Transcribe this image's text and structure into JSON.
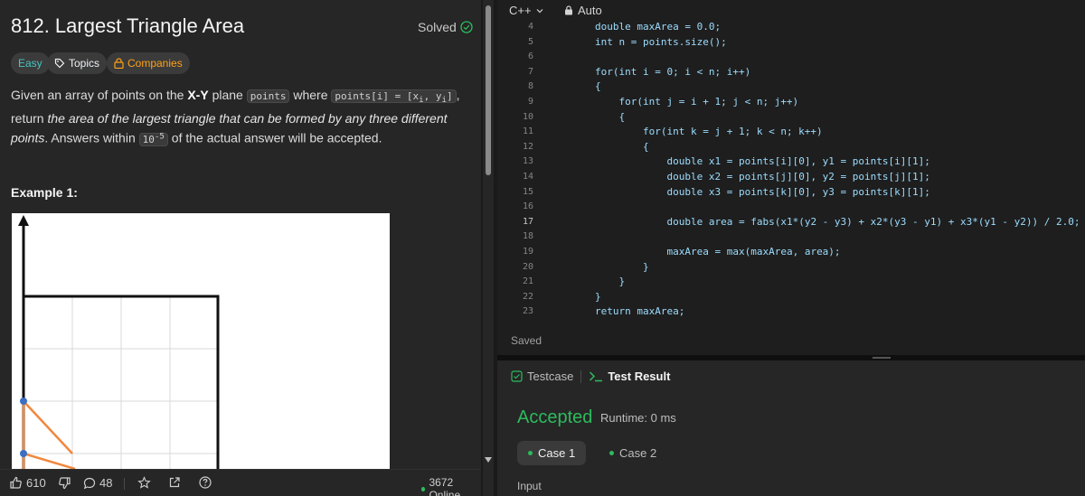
{
  "problem": {
    "title": "812. Largest Triangle Area",
    "solved_label": "Solved",
    "tags": {
      "difficulty": "Easy",
      "topics": "Topics",
      "companies": "Companies"
    },
    "description": {
      "part1": "Given an array of points on the ",
      "bold": "X-Y",
      "part2": " plane ",
      "code1": "points",
      "part3": " where ",
      "code2": "points[i] = [x",
      "code2_sub1": "i",
      "code2_mid": ", y",
      "code2_sub2": "i",
      "code2_end": "]",
      "part4": ", return ",
      "italic": "the area of the largest triangle that can be formed by any three different points",
      "part5": ". Answers within ",
      "code3": "10",
      "code3_sup": "-5",
      "part6": " of the actual answer will be accepted."
    },
    "example_title": "Example 1:"
  },
  "bottom_bar": {
    "likes": "610",
    "comments": "48",
    "online": "3672 Online"
  },
  "editor": {
    "language": "C++",
    "mode": "Auto",
    "saved": "Saved",
    "lines": [
      {
        "n": "4",
        "code": "double maxArea = 0.0;",
        "indent": 0
      },
      {
        "n": "5",
        "code": "int n = points.size();",
        "indent": 0
      },
      {
        "n": "6",
        "code": "",
        "indent": 0
      },
      {
        "n": "7",
        "code": "for(int i = 0; i < n; i++)",
        "indent": 0
      },
      {
        "n": "8",
        "code": "{",
        "indent": 0
      },
      {
        "n": "9",
        "code": "for(int j = i + 1; j < n; j++)",
        "indent": 1
      },
      {
        "n": "10",
        "code": "{",
        "indent": 1
      },
      {
        "n": "11",
        "code": "for(int k = j + 1; k < n; k++)",
        "indent": 2
      },
      {
        "n": "12",
        "code": "{",
        "indent": 2
      },
      {
        "n": "13",
        "code": "double x1 = points[i][0], y1 = points[i][1];",
        "indent": 3
      },
      {
        "n": "14",
        "code": "double x2 = points[j][0], y2 = points[j][1];",
        "indent": 3
      },
      {
        "n": "15",
        "code": "double x3 = points[k][0], y3 = points[k][1];",
        "indent": 3
      },
      {
        "n": "16",
        "code": "",
        "indent": 0
      },
      {
        "n": "17",
        "code": "double area = fabs(x1*(y2 - y3) + x2*(y3 - y1) + x3*(y1 - y2)) / 2.0;",
        "indent": 3
      },
      {
        "n": "18",
        "code": "",
        "indent": 0
      },
      {
        "n": "19",
        "code": "maxArea = max(maxArea, area);",
        "indent": 3
      },
      {
        "n": "20",
        "code": "}",
        "indent": 2
      },
      {
        "n": "21",
        "code": "}",
        "indent": 1
      },
      {
        "n": "22",
        "code": "}",
        "indent": 0
      },
      {
        "n": "23",
        "code": "return maxArea;",
        "indent": 0
      }
    ]
  },
  "results": {
    "tab_testcase": "Testcase",
    "tab_result": "Test Result",
    "status": "Accepted",
    "runtime": "Runtime: 0 ms",
    "case1": "Case 1",
    "case2": "Case 2",
    "input_label": "Input"
  },
  "colors": {
    "accepted": "#2cbb5d",
    "easy": "#46c6c2",
    "companies": "#ffa116",
    "triangle_line": "#f0883e",
    "point": "#3b6fc4"
  }
}
